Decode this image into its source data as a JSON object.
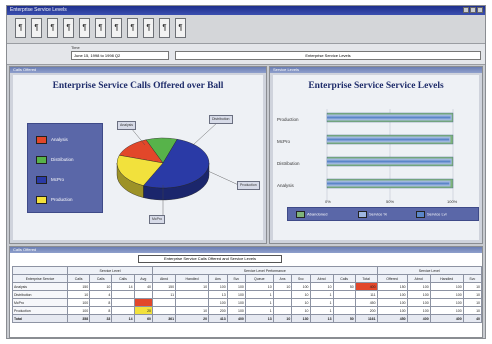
{
  "window": {
    "title": "Enterprise Service Levels"
  },
  "toolbar": {
    "buttons": [
      {
        "name": "tool-button-1",
        "glyph": "¶"
      },
      {
        "name": "tool-button-2",
        "glyph": "¶"
      },
      {
        "name": "tool-button-3",
        "glyph": "¶"
      },
      {
        "name": "tool-button-4",
        "glyph": "¶"
      },
      {
        "name": "tool-button-5",
        "glyph": "¶"
      },
      {
        "name": "tool-button-6",
        "glyph": "¶"
      },
      {
        "name": "tool-button-7",
        "glyph": "¶"
      },
      {
        "name": "tool-button-8",
        "glyph": "¶"
      },
      {
        "name": "tool-button-9",
        "glyph": "¶"
      },
      {
        "name": "tool-button-10",
        "glyph": "¶"
      },
      {
        "name": "tool-button-11",
        "glyph": "¶"
      }
    ]
  },
  "filter": {
    "label": "Time",
    "value": "June 15, 1998 to 1998 Q2",
    "caption": "Enterprise Service Levels"
  },
  "left_panel": {
    "header": "Calls Offered"
  },
  "right_panel": {
    "header": "Service Levels"
  },
  "pie_chart": {
    "title": "Enterprise Service Calls Offered over Ball",
    "legend": [
      "Analysis",
      "Distribution",
      "McPro",
      "Production"
    ],
    "colors": {
      "Analysis": "#e2472a",
      "Distribution": "#57b34a",
      "McPro": "#2a3aa6",
      "Production": "#f2e13c"
    },
    "callouts": [
      "Analysis",
      "Distribution",
      "McPro",
      "Production"
    ]
  },
  "chart_data": [
    {
      "type": "pie",
      "title": "Enterprise Service Calls Offered over Ball",
      "labels": [
        "Analysis",
        "Distribution",
        "McPro",
        "Production"
      ],
      "values": [
        14,
        11,
        52,
        23
      ]
    },
    {
      "type": "bar",
      "title": "Enterprise Service Service Levels",
      "orientation": "horizontal",
      "categories": [
        "Production",
        "McPro",
        "Distribution",
        "Analysis"
      ],
      "series": [
        {
          "name": "Abandoned",
          "values": [
            100,
            100,
            100,
            100
          ]
        },
        {
          "name": "Service %",
          "values": [
            99,
            98,
            99,
            98
          ]
        },
        {
          "name": "Service Lvl",
          "values": [
            98,
            97,
            98,
            97
          ]
        }
      ],
      "xlim": [
        0,
        100
      ],
      "xticks": [
        "0%",
        "50%",
        "100%"
      ],
      "legend": "bottom"
    }
  ],
  "bar_chart": {
    "title": "Enterprise Service Service Levels",
    "labels": [
      "Production",
      "McPro",
      "Distribution",
      "Analysis"
    ],
    "ticks": [
      "0%",
      "50%",
      "100%"
    ],
    "legend": [
      "Abandoned",
      "Service %",
      "Service Lvl"
    ],
    "colors": {
      "Abandoned": "#7fb47a",
      "Service %": "#9fb6e0",
      "Service Lvl": "#5b86c8"
    }
  },
  "report": {
    "header": "Calls Offered",
    "title": "Enterprise Service Calls Offered and Service Levels",
    "group_headers": [
      "Service Level",
      "Service Level Performance",
      "Service Level"
    ],
    "columns": [
      "Enterprise Service",
      "Calls",
      "Calls",
      "Calls",
      "Avg",
      "Abnd",
      "Handled",
      "Ans",
      "Svc",
      "Queue",
      "Ans",
      "Svc",
      "Abnd",
      "Calls",
      "Total",
      "Offered",
      "Abnd",
      "Handled",
      "Svc"
    ],
    "rows": [
      {
        "name": "Analysis",
        "cells": [
          "150",
          "10",
          "14",
          "40",
          "150",
          "10",
          "100",
          "100",
          "10",
          "10",
          "100",
          "10",
          "50",
          "400",
          "150",
          "100",
          "100",
          "10"
        ]
      },
      {
        "name": "Distribution",
        "cells": [
          "10",
          "4",
          "",
          "",
          "11",
          "",
          "13",
          "100",
          "1",
          "",
          "10",
          "1",
          "",
          "111",
          "100",
          "100",
          "100",
          "10"
        ]
      },
      {
        "name": "McPro",
        "cells": [
          "100",
          "8",
          "",
          "",
          "",
          "",
          "100",
          "100",
          "1",
          "",
          "10",
          "1",
          "",
          "450",
          "100",
          "100",
          "100",
          "10"
        ]
      },
      {
        "name": "Production",
        "cells": [
          "100",
          "8",
          "",
          "20",
          "",
          "10",
          "200",
          "100",
          "1",
          "",
          "10",
          "1",
          "",
          "200",
          "100",
          "100",
          "100",
          "10"
        ]
      },
      {
        "name": "Total",
        "cells": [
          "358",
          "33",
          "14",
          "60",
          "361",
          "20",
          "413",
          "400",
          "13",
          "10",
          "130",
          "13",
          "50",
          "1161",
          "450",
          "400",
          "400",
          "40"
        ]
      }
    ],
    "highlight_colors": {
      "red": "#e2472a",
      "yellow": "#f2e13c"
    }
  }
}
